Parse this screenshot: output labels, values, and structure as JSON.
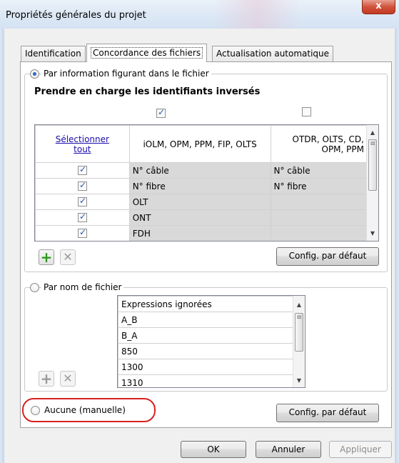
{
  "window": {
    "title": "Propriétés générales du projet",
    "close_label": "x"
  },
  "tabs": [
    "Identification",
    "Concordance des fichiers",
    "Actualisation automatique"
  ],
  "by_info": {
    "label": "Par information figurant dans le fichier",
    "header": "Prendre en charge les identifiants inversés",
    "col1_checked": true,
    "col2_checked": false,
    "select_all": "Sélectionner tout",
    "col_headers": [
      "iOLM, OPM, PPM, FIP, OLTS",
      "OTDR, OLTS, CD, OPM, PPM"
    ],
    "rows": [
      {
        "checked": true,
        "c1": "N° câble",
        "c2": "N° câble"
      },
      {
        "checked": true,
        "c1": "N° fibre",
        "c2": "N° fibre"
      },
      {
        "checked": true,
        "c1": "OLT",
        "c2": ""
      },
      {
        "checked": true,
        "c1": "ONT",
        "c2": ""
      },
      {
        "checked": true,
        "c1": "FDH",
        "c2": ""
      }
    ],
    "default_btn": "Config. par défaut"
  },
  "by_name": {
    "label": "Par nom de fichier",
    "list_header": "Expressions ignorées",
    "items": [
      "A_B",
      "B_A",
      "850",
      "1300",
      "1310"
    ]
  },
  "none": {
    "label": "Aucune (manuelle)",
    "default_btn": "Config. par défaut"
  },
  "footer": {
    "ok": "OK",
    "cancel": "Annuler",
    "apply": "Appliquer"
  },
  "icons": {
    "add": "plus-icon",
    "remove": "close-x-icon",
    "scroll_up": "chevron-up-icon",
    "scroll_down": "chevron-down-icon"
  }
}
